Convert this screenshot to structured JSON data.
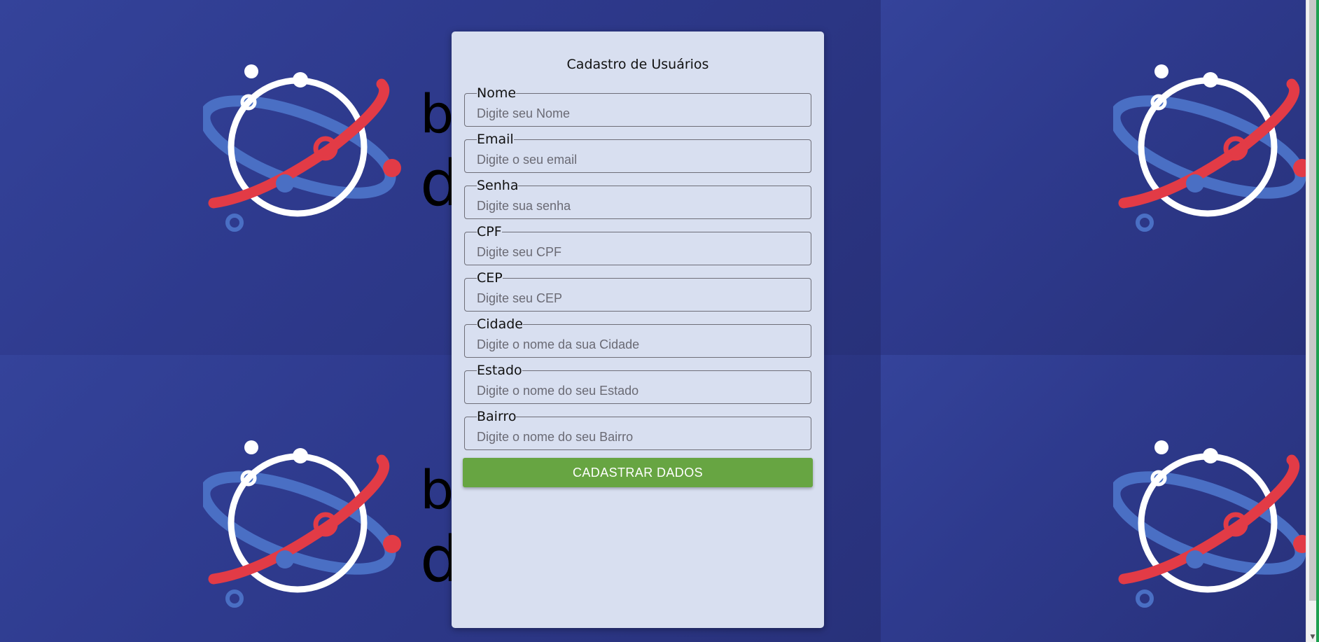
{
  "background": {
    "brand_top": "bemol",
    "brand_bottom": "digital",
    "colors": {
      "navy": "#2e3a8d",
      "logo_blue": "#4a6fc4",
      "logo_red": "#e23b46",
      "logo_white": "#ffffff"
    }
  },
  "form": {
    "title": "Cadastro de Usuários",
    "fields": [
      {
        "label": "Nome",
        "placeholder": "Digite seu Nome",
        "value": ""
      },
      {
        "label": "Email",
        "placeholder": "Digite o seu email",
        "value": ""
      },
      {
        "label": "Senha",
        "placeholder": "Digite sua senha",
        "value": ""
      },
      {
        "label": "CPF",
        "placeholder": "Digite seu CPF",
        "value": ""
      },
      {
        "label": "CEP",
        "placeholder": "Digite seu CEP",
        "value": ""
      },
      {
        "label": "Cidade",
        "placeholder": "Digite o nome da sua Cidade",
        "value": ""
      },
      {
        "label": "Estado",
        "placeholder": "Digite o nome do seu Estado",
        "value": ""
      },
      {
        "label": "Bairro",
        "placeholder": "Digite o nome do seu Bairro",
        "value": ""
      }
    ],
    "submit_label": "CADASTRAR DADOS",
    "colors": {
      "card": "#d8dff0",
      "button": "#67a542"
    }
  }
}
